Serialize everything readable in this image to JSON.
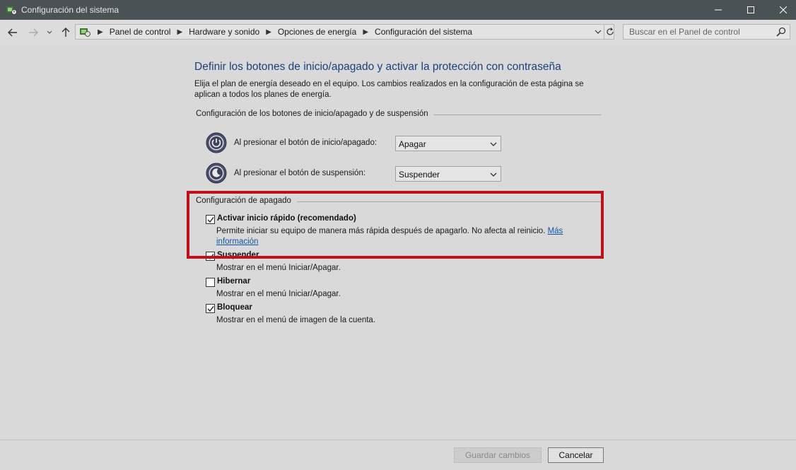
{
  "window": {
    "title": "Configuración del sistema"
  },
  "address": {
    "crumbs": [
      "Panel de control",
      "Hardware y sonido",
      "Opciones de energía",
      "Configuración del sistema"
    ],
    "search_placeholder": "Buscar en el Panel de control"
  },
  "main": {
    "heading": "Definir los botones de inicio/apagado y activar la protección con contraseña",
    "intro": "Elija el plan de energía deseado en el equipo. Los cambios realizados en la configuración de esta página se aplican a todos los planes de energía.",
    "buttons_group_title": "Configuración de los botones de inicio/apagado y de suspensión",
    "power_button_label": "Al presionar el botón de inicio/apagado:",
    "power_button_value": "Apagar",
    "sleep_button_label": "Al presionar el botón de suspensión:",
    "sleep_button_value": "Suspender",
    "shutdown_group_title": "Configuración de apagado",
    "options": [
      {
        "label": "Activar inicio rápido (recomendado)",
        "checked": true,
        "description": "Permite iniciar su equipo de manera más rápida después de apagarlo. No afecta al reinicio.",
        "link_part1": "Más",
        "link_part2": "información"
      },
      {
        "label": "Suspender",
        "checked": true,
        "description": "Mostrar en el menú Iniciar/Apagar."
      },
      {
        "label": "Hibernar",
        "checked": false,
        "description": "Mostrar en el menú Iniciar/Apagar."
      },
      {
        "label": "Bloquear",
        "checked": true,
        "description": "Mostrar en el menú de imagen de la cuenta."
      }
    ]
  },
  "footer": {
    "save_label": "Guardar cambios",
    "cancel_label": "Cancelar"
  },
  "colors": {
    "titlebar": "#4a5256",
    "heading": "#1d3f7a",
    "highlight": "#c0101a",
    "link": "#1155a8"
  }
}
